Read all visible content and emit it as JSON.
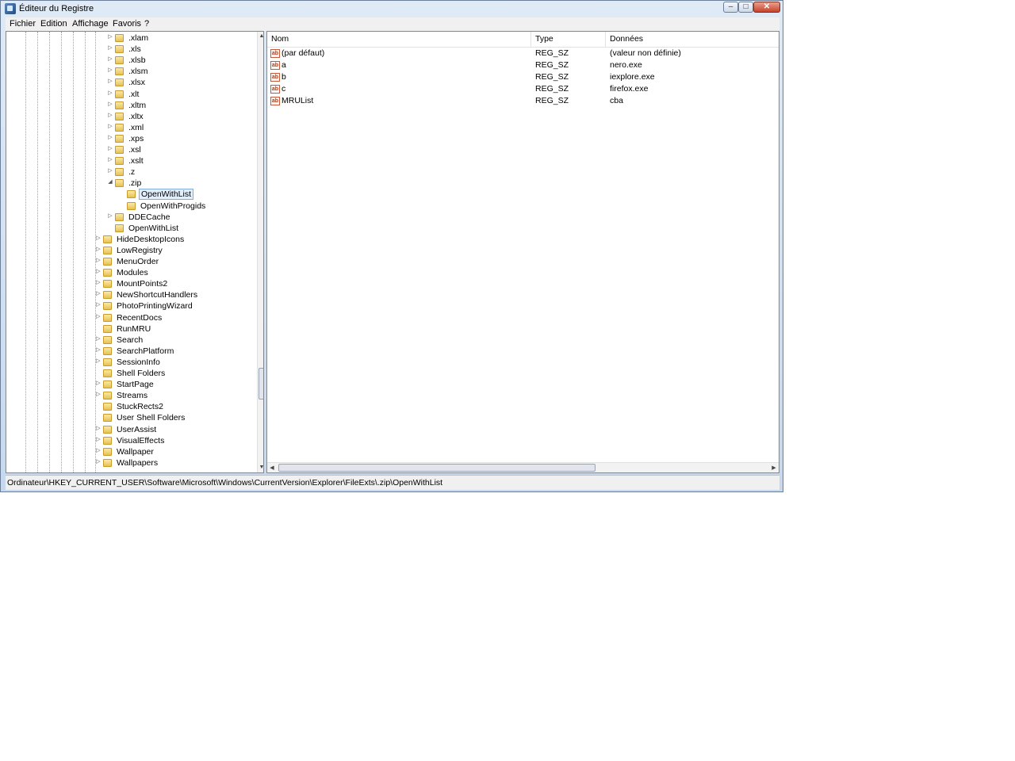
{
  "window": {
    "title": "Éditeur du Registre"
  },
  "menu": [
    "Fichier",
    "Edition",
    "Affichage",
    "Favoris",
    "?"
  ],
  "tree": {
    "items": [
      {
        "label": ".xlam",
        "level": 2,
        "expander": "collapsed"
      },
      {
        "label": ".xls",
        "level": 2,
        "expander": "collapsed"
      },
      {
        "label": ".xlsb",
        "level": 2,
        "expander": "collapsed"
      },
      {
        "label": ".xlsm",
        "level": 2,
        "expander": "collapsed"
      },
      {
        "label": ".xlsx",
        "level": 2,
        "expander": "collapsed"
      },
      {
        "label": ".xlt",
        "level": 2,
        "expander": "collapsed"
      },
      {
        "label": ".xltm",
        "level": 2,
        "expander": "collapsed"
      },
      {
        "label": ".xltx",
        "level": 2,
        "expander": "collapsed"
      },
      {
        "label": ".xml",
        "level": 2,
        "expander": "collapsed"
      },
      {
        "label": ".xps",
        "level": 2,
        "expander": "collapsed"
      },
      {
        "label": ".xsl",
        "level": 2,
        "expander": "collapsed"
      },
      {
        "label": ".xslt",
        "level": 2,
        "expander": "collapsed"
      },
      {
        "label": ".z",
        "level": 2,
        "expander": "collapsed"
      },
      {
        "label": ".zip",
        "level": 2,
        "expander": "expanded"
      },
      {
        "label": "OpenWithList",
        "level": 3,
        "expander": "none",
        "selected": true
      },
      {
        "label": "OpenWithProgids",
        "level": 3,
        "expander": "none"
      },
      {
        "label": "DDECache",
        "level": 2,
        "expander": "collapsed"
      },
      {
        "label": "OpenWithList",
        "level": 2,
        "expander": "none"
      },
      {
        "label": "HideDesktopIcons",
        "level": 1,
        "expander": "collapsed"
      },
      {
        "label": "LowRegistry",
        "level": 1,
        "expander": "collapsed"
      },
      {
        "label": "MenuOrder",
        "level": 1,
        "expander": "collapsed"
      },
      {
        "label": "Modules",
        "level": 1,
        "expander": "collapsed"
      },
      {
        "label": "MountPoints2",
        "level": 1,
        "expander": "collapsed"
      },
      {
        "label": "NewShortcutHandlers",
        "level": 1,
        "expander": "collapsed"
      },
      {
        "label": "PhotoPrintingWizard",
        "level": 1,
        "expander": "collapsed"
      },
      {
        "label": "RecentDocs",
        "level": 1,
        "expander": "collapsed"
      },
      {
        "label": "RunMRU",
        "level": 1,
        "expander": "none"
      },
      {
        "label": "Search",
        "level": 1,
        "expander": "collapsed"
      },
      {
        "label": "SearchPlatform",
        "level": 1,
        "expander": "collapsed"
      },
      {
        "label": "SessionInfo",
        "level": 1,
        "expander": "collapsed"
      },
      {
        "label": "Shell Folders",
        "level": 1,
        "expander": "none"
      },
      {
        "label": "StartPage",
        "level": 1,
        "expander": "collapsed"
      },
      {
        "label": "Streams",
        "level": 1,
        "expander": "collapsed"
      },
      {
        "label": "StuckRects2",
        "level": 1,
        "expander": "none"
      },
      {
        "label": "User Shell Folders",
        "level": 1,
        "expander": "none"
      },
      {
        "label": "UserAssist",
        "level": 1,
        "expander": "collapsed"
      },
      {
        "label": "VisualEffects",
        "level": 1,
        "expander": "collapsed"
      },
      {
        "label": "Wallpaper",
        "level": 1,
        "expander": "collapsed"
      },
      {
        "label": "Wallpapers",
        "level": 1,
        "expander": "collapsed"
      }
    ]
  },
  "list": {
    "columns": [
      "Nom",
      "Type",
      "Données"
    ],
    "rows": [
      {
        "icon": "string-value-icon",
        "name": "(par défaut)",
        "type": "REG_SZ",
        "data": "(valeur non définie)"
      },
      {
        "icon": "string-value-icon",
        "name": "a",
        "type": "REG_SZ",
        "data": "nero.exe"
      },
      {
        "icon": "string-value-icon",
        "name": "b",
        "type": "REG_SZ",
        "data": "iexplore.exe"
      },
      {
        "icon": "string-value-icon",
        "name": "c",
        "type": "REG_SZ",
        "data": "firefox.exe"
      },
      {
        "icon": "string-value-icon",
        "name": "MRUList",
        "type": "REG_SZ",
        "data": "cba"
      }
    ]
  },
  "status": {
    "path": "Ordinateur\\HKEY_CURRENT_USER\\Software\\Microsoft\\Windows\\CurrentVersion\\Explorer\\FileExts\\.zip\\OpenWithList"
  }
}
